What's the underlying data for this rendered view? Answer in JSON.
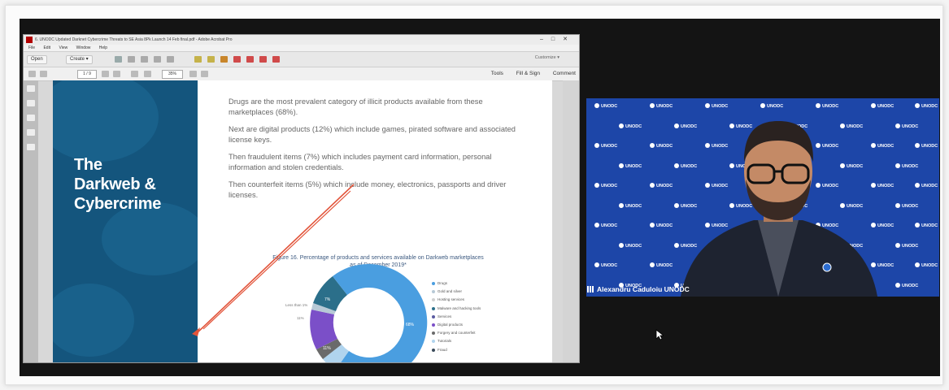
{
  "acrobat": {
    "title": "6. UNODC Updated Darknet Cybercrime Threats to SE Asia 8Pk Launch 14 Feb final.pdf - Adobe Acrobat Pro",
    "menu": [
      "File",
      "Edit",
      "View",
      "Window",
      "Help"
    ],
    "toolbar": {
      "open": "Open",
      "create": "Create ▾",
      "customize": "Customize ▾"
    },
    "page_indicator": "1 / 9",
    "zoom": "35%",
    "right_tabs": [
      "Tools",
      "Fill & Sign",
      "Comment"
    ]
  },
  "slide": {
    "title_lines": [
      "The",
      "Darkweb &",
      "Cybercrime"
    ],
    "paragraphs": [
      "Drugs are the most prevalent category of illicit products available from these marketplaces (68%).",
      "Next are digital products (12%) which include games, pirated software and associated license keys.",
      "Then fraudulent items (7%) which includes payment card information, personal information and stolen credentials.",
      "Then counterfeit items (5%) which include money, electronics, passports and driver licenses."
    ],
    "figure_caption": "Figure 16. Percentage of products and services available on Darkweb marketplaces as of December 2019*",
    "chart_labels": {
      "big": "68%",
      "purple": "11%",
      "teal": "7%",
      "cyan": "4%",
      "outer": "11%",
      "lessthan": "Less than 1%"
    },
    "legend": [
      "Drugs",
      "Gold and silver",
      "Hosting services",
      "Malware and hacking tools",
      "Services",
      "Digital products",
      "Forgery and counterfeit",
      "Tutorials",
      "Fraud"
    ],
    "colors": {
      "drugs": "#4a9ee0",
      "gold": "#b7c9d6",
      "hosting": "#d0d0d0",
      "malware": "#2b6f8a",
      "services": "#5a5aa0",
      "digital": "#7b4fc8",
      "forgery": "#6a6a6a",
      "tutorials": "#b0d4ee",
      "fraud": "#3a4a5a"
    }
  },
  "webcam": {
    "backdrop_logo": "UNODC",
    "participant_name": "Alexandru Caduloiu UNODC"
  }
}
